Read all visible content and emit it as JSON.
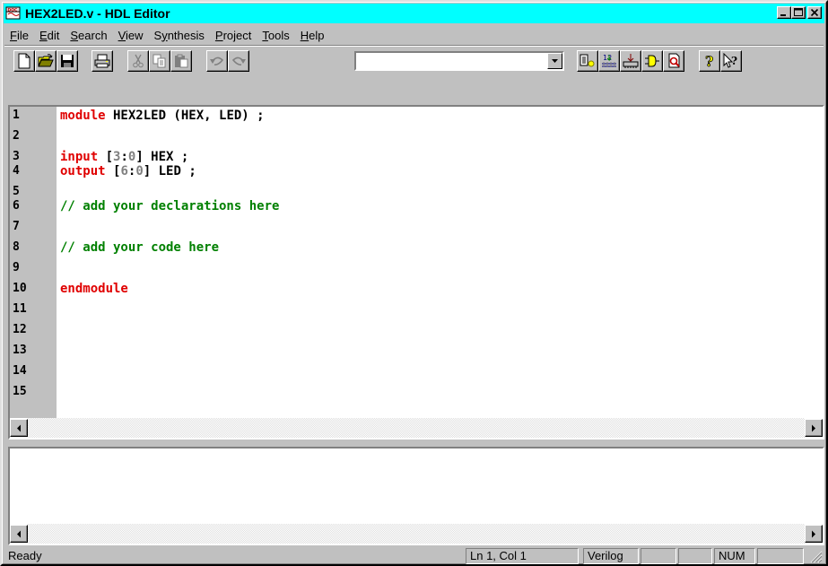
{
  "window": {
    "title": "HEX2LED.v - HDL Editor"
  },
  "menu": {
    "items": [
      {
        "label": "File",
        "u": "F",
        "rest": "ile"
      },
      {
        "label": "Edit",
        "u": "E",
        "rest": "dit"
      },
      {
        "label": "Search",
        "u": "S",
        "rest": "earch"
      },
      {
        "label": "View",
        "u": "V",
        "rest": "iew"
      },
      {
        "label": "Synthesis",
        "pre": "S",
        "u": "y",
        "rest": "nthesis"
      },
      {
        "label": "Project",
        "u": "P",
        "rest": "roject"
      },
      {
        "label": "Tools",
        "u": "T",
        "rest": "ools"
      },
      {
        "label": "Help",
        "u": "H",
        "rest": "elp"
      }
    ]
  },
  "toolbar": {
    "combo_value": "",
    "icons": [
      "new-document-icon",
      "open-folder-icon",
      "save-icon",
      "print-icon",
      "cut-icon",
      "copy-icon",
      "paste-icon",
      "undo-icon",
      "redo-icon",
      "language-assistant-icon",
      "synthesis-icon",
      "implementation-icon",
      "diagram-icon",
      "search-icon",
      "help-icon",
      "context-help-icon"
    ]
  },
  "editor": {
    "line_numbers": [
      "1",
      "2",
      "3",
      "4",
      "5",
      "6",
      "7",
      "8",
      "9",
      "10",
      "11",
      "12",
      "13",
      "14",
      "15"
    ],
    "lines": [
      {
        "n": 1,
        "parts": [
          {
            "t": "module",
            "c": "kw"
          },
          {
            "t": " HEX2LED (HEX, LED) ;",
            "c": "bk"
          }
        ]
      },
      {
        "n": 3,
        "parts": [
          {
            "t": "input",
            "c": "kw"
          },
          {
            "t": " [",
            "c": "bk"
          },
          {
            "t": "3",
            "c": "gr"
          },
          {
            "t": ":",
            "c": "bk"
          },
          {
            "t": "0",
            "c": "gr"
          },
          {
            "t": "] HEX ;",
            "c": "bk"
          }
        ]
      },
      {
        "n": 4,
        "parts": [
          {
            "t": "output",
            "c": "kw"
          },
          {
            "t": " [",
            "c": "bk"
          },
          {
            "t": "6",
            "c": "gr"
          },
          {
            "t": ":",
            "c": "bk"
          },
          {
            "t": "0",
            "c": "gr"
          },
          {
            "t": "] LED ;",
            "c": "bk"
          }
        ]
      },
      {
        "n": 6,
        "parts": [
          {
            "t": "// add your declarations here",
            "c": "cm"
          }
        ]
      },
      {
        "n": 8,
        "parts": [
          {
            "t": "// add your code here",
            "c": "cm"
          }
        ]
      },
      {
        "n": 10,
        "parts": [
          {
            "t": "endmodule",
            "c": "kw"
          }
        ]
      }
    ]
  },
  "status": {
    "ready": "Ready",
    "position": "Ln 1, Col 1",
    "language": "Verilog",
    "num": "NUM"
  },
  "colors": {
    "titlebar": "#00ffff",
    "keyword": "#e00000",
    "comment": "#008000",
    "number": "#808080"
  }
}
